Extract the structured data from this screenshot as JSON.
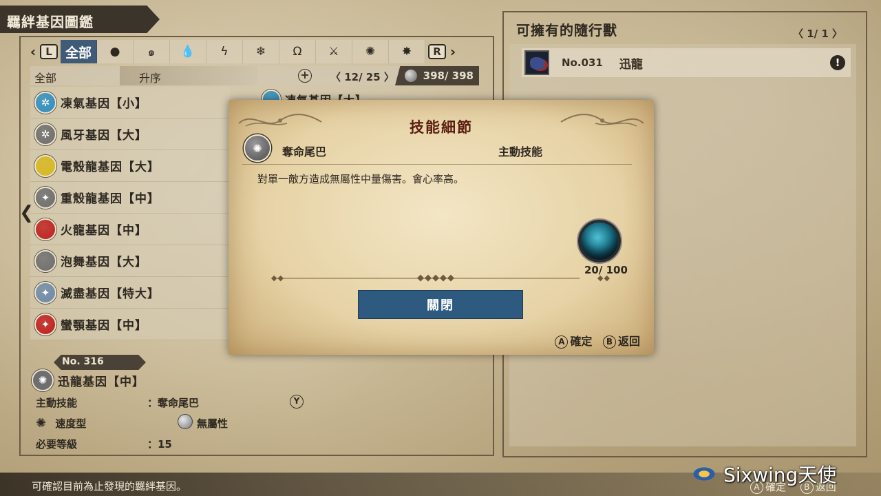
{
  "header": {
    "title": "羈絆基因圖鑑"
  },
  "tabs": {
    "left_shoulder": "L",
    "right_shoulder": "R",
    "items": [
      {
        "label": "全部",
        "icon": "all-label"
      },
      {
        "label": "●",
        "icon": "no-element-icon"
      },
      {
        "label": "๑",
        "icon": "fire-swirl-icon"
      },
      {
        "label": "💧",
        "icon": "water-drop-icon"
      },
      {
        "label": "ϟ",
        "icon": "thunder-icon"
      },
      {
        "label": "❄",
        "icon": "ice-icon"
      },
      {
        "label": "Ω",
        "icon": "dragon-icon"
      },
      {
        "label": "⚔",
        "icon": "power-type-icon"
      },
      {
        "label": "✺",
        "icon": "speed-type-icon"
      },
      {
        "label": "✸",
        "icon": "technique-type-icon"
      }
    ]
  },
  "filter": {
    "category": "全部",
    "sort": "升序",
    "plus": "+",
    "page": "〈 12/ 25 〉",
    "count": "398/ 398"
  },
  "genes": [
    {
      "name": "凍氣基因【小】",
      "color": "#2f8fc0"
    },
    {
      "name": "風牙基因【大】",
      "color": "#6e6e6e"
    },
    {
      "name": "電殼龍基因【大】",
      "color": "#d8b81e"
    },
    {
      "name": "重殼龍基因【中】",
      "color": "#6e6e6e"
    },
    {
      "name": "火龍基因【中】",
      "color": "#c0201e"
    },
    {
      "name": "泡舞基因【大】",
      "color": "#6e6e6e"
    },
    {
      "name": "滅盡基因【特大】",
      "color": "#6e8aa8"
    },
    {
      "name": "蠻顎基因【中】",
      "color": "#c0201e"
    }
  ],
  "peek_gene": {
    "name": "凍氣基因【大】",
    "color": "#2f8fc0"
  },
  "detail": {
    "no": "No.  316",
    "name": "迅龍基因【中】",
    "skill_label": "主動技能",
    "skill_value": "：奪命尾巴",
    "y_button": "Y",
    "type": "速度型",
    "element": "無屬性",
    "level_label": "必要等級",
    "level_value": "：15"
  },
  "right": {
    "title": "可擁有的隨行獸",
    "page": "〈 1/   1 〉",
    "companions": [
      {
        "no": "No.031",
        "name": "迅龍",
        "alert": "!"
      }
    ]
  },
  "modal": {
    "title": "技能細節",
    "skill_name": "奪命尾巴",
    "skill_type": "主動技能",
    "description": "對單一敵方造成無屬性中量傷害。會心率高。",
    "cost": "20/ 100",
    "close_label": "關閉",
    "hint_a_btn": "A",
    "hint_a": "確定",
    "hint_b_btn": "B",
    "hint_b": "返回"
  },
  "bottom": {
    "hint": "可確認目前為止發現的羈絆基因。",
    "a_btn": "A",
    "a_label": "確定",
    "b_btn": "B",
    "b_label": "返回",
    "watermark": "Sixwing天使"
  }
}
